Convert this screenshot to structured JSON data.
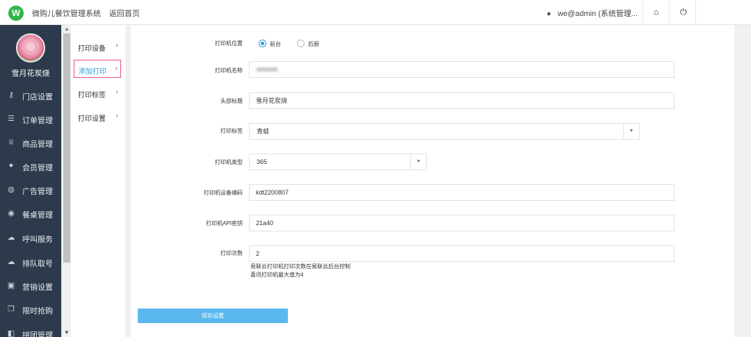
{
  "header": {
    "app_title": "微购儿餐饮管理系统",
    "back_home": "返回首页",
    "user": "we@admin (系统管理...",
    "logo_icon": "w-logo-icon",
    "home_icon": "home-icon",
    "power_icon": "power-icon"
  },
  "sidebar": {
    "shop_name": "雪月花炭烧",
    "items": [
      {
        "label": "门店设置",
        "icon": "key-icon",
        "glyph": "⚷"
      },
      {
        "label": "订单管理",
        "icon": "list-icon",
        "glyph": "☰"
      },
      {
        "label": "商品管理",
        "icon": "trophy-icon",
        "glyph": "♕"
      },
      {
        "label": "会员管理",
        "icon": "user-icon",
        "glyph": "●"
      },
      {
        "label": "广告管理",
        "icon": "globe-icon",
        "glyph": "◍"
      },
      {
        "label": "餐桌管理",
        "icon": "binoculars-icon",
        "glyph": "◉"
      },
      {
        "label": "呼叫服务",
        "icon": "cloud-icon",
        "glyph": "☁"
      },
      {
        "label": "排队取号",
        "icon": "cloud-upload-icon",
        "glyph": "☁"
      },
      {
        "label": "营销设置",
        "icon": "gift-icon",
        "glyph": "▣"
      },
      {
        "label": "限时抢购",
        "icon": "copy-icon",
        "glyph": "❐"
      },
      {
        "label": "拼团管理",
        "icon": "group-icon",
        "glyph": "◧"
      }
    ]
  },
  "subnav": {
    "items": [
      {
        "label": "打印设备",
        "active": false
      },
      {
        "label": "添加打印",
        "active": true
      },
      {
        "label": "打印标签",
        "active": false
      },
      {
        "label": "打印设置",
        "active": false
      }
    ]
  },
  "form": {
    "position_label": "打印机位置",
    "position_options": [
      "前台",
      "后厨"
    ],
    "position_selected": "前台",
    "name_label": "打印机名称",
    "title_label": "头部标题",
    "title_value": "雪月花炭烧",
    "tag_label": "打印标签",
    "tag_value": "青蛙",
    "type_label": "打印机类型",
    "type_value": "365",
    "code_label": "打印机设备编码",
    "code_value": "kdt2200807",
    "api_label": "打印机API密钥",
    "api_value": "21a40",
    "count_label": "打印次数",
    "count_value": "2",
    "hint1": "易联云打印机打印次数在易联云后台控制",
    "hint2": "喜讯打印机最大值为4",
    "save_label": "保存设置"
  }
}
